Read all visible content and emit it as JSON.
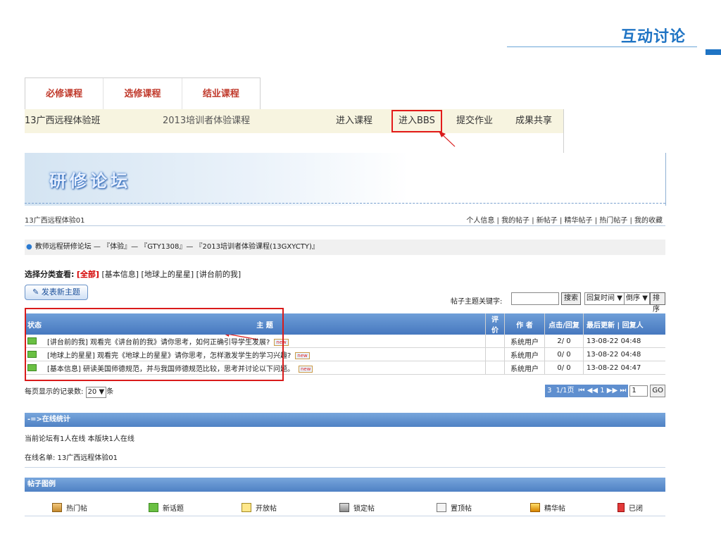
{
  "slide": {
    "title": "互动讨论"
  },
  "course_tabs": [
    "必修课程",
    "选修课程",
    "结业课程"
  ],
  "course_bar": {
    "class_name": "13广西远程体验班",
    "course": "2013培训者体验课程",
    "actions": [
      "进入课程",
      "进入BBS",
      "提交作业",
      "成果共享"
    ]
  },
  "banner": {
    "title": "研修论坛"
  },
  "user_bar": {
    "username": "13广西远程体验01",
    "links": [
      "个人信息",
      "我的帖子",
      "新帖子",
      "精华帖子",
      "热门帖子",
      "我的收藏"
    ]
  },
  "breadcrumb": "教师远程研修论坛 — 『体验』— 『GTY1308』— 『2013培训者体验课程(13GXYCTY)』",
  "categories": {
    "label": "选择分类查看:",
    "active": "[全部]",
    "others": "[基本信息] [地球上的星星] [讲台前的我]"
  },
  "new_topic_button": "发表新主题",
  "search": {
    "label": "帖子主题关键字:",
    "button": "搜索",
    "sort_field": "回复时间",
    "sort_order": "倒序",
    "sort_button": "排序"
  },
  "table": {
    "headers": {
      "status": "状态",
      "topic": "主 题",
      "rating": "评价",
      "author": "作 者",
      "clicks": "点击/回复",
      "last": "最后更新 | 回复人"
    },
    "rows": [
      {
        "topic": "[讲台前的我] 观看完《讲台前的我》请你思考，如何正确引导学生发展?",
        "author": "系统用户",
        "clicks": "2/ 0",
        "last": "13-08-22 04:48"
      },
      {
        "topic": "[地球上的星星] 观看完《地球上的星星》请你思考，怎样激发学生的学习兴趣?",
        "author": "系统用户",
        "clicks": "0/ 0",
        "last": "13-08-22 04:48"
      },
      {
        "topic": "[基本信息] 研读美国师德规范，并与我国师德规范比较，思考并讨论以下问题。",
        "author": "系统用户",
        "clicks": "0/ 0",
        "last": "13-08-22 04:47"
      }
    ],
    "tag": "new"
  },
  "per_page": {
    "label": "每页显示的记录数:",
    "value": "20",
    "unit": "条"
  },
  "pager": {
    "total": "3",
    "page": "1/1页",
    "nav": "⏮ ◀◀ 1 ▶▶ ⏭",
    "input": "1",
    "go": "GO"
  },
  "online": {
    "header": "-=>在线统计",
    "line1": "当前论坛有1人在线  本版块1人在线",
    "line2": "在线名单: 13广西远程体验01"
  },
  "legend": {
    "header": "帖子图例",
    "items": [
      "热门帖",
      "新话题",
      "开放帖",
      "锁定帖",
      "置顶帖",
      "精华帖",
      "已闭"
    ]
  },
  "colors": {
    "accent": "#1f74c4",
    "table_header": "#4678bf",
    "highlight": "#d91b1b"
  }
}
